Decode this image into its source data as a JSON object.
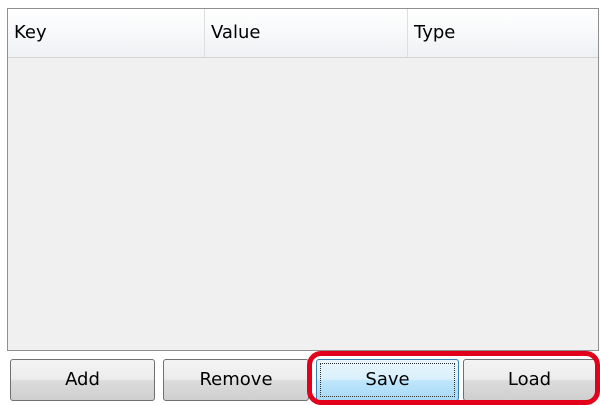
{
  "table": {
    "columns": [
      "Key",
      "Value",
      "Type"
    ],
    "rows": []
  },
  "buttons": {
    "add": "Add",
    "remove": "Remove",
    "save": "Save",
    "load": "Load"
  },
  "colors": {
    "highlight": "#e3001b",
    "save_button_accent": "#3c7fb1"
  }
}
